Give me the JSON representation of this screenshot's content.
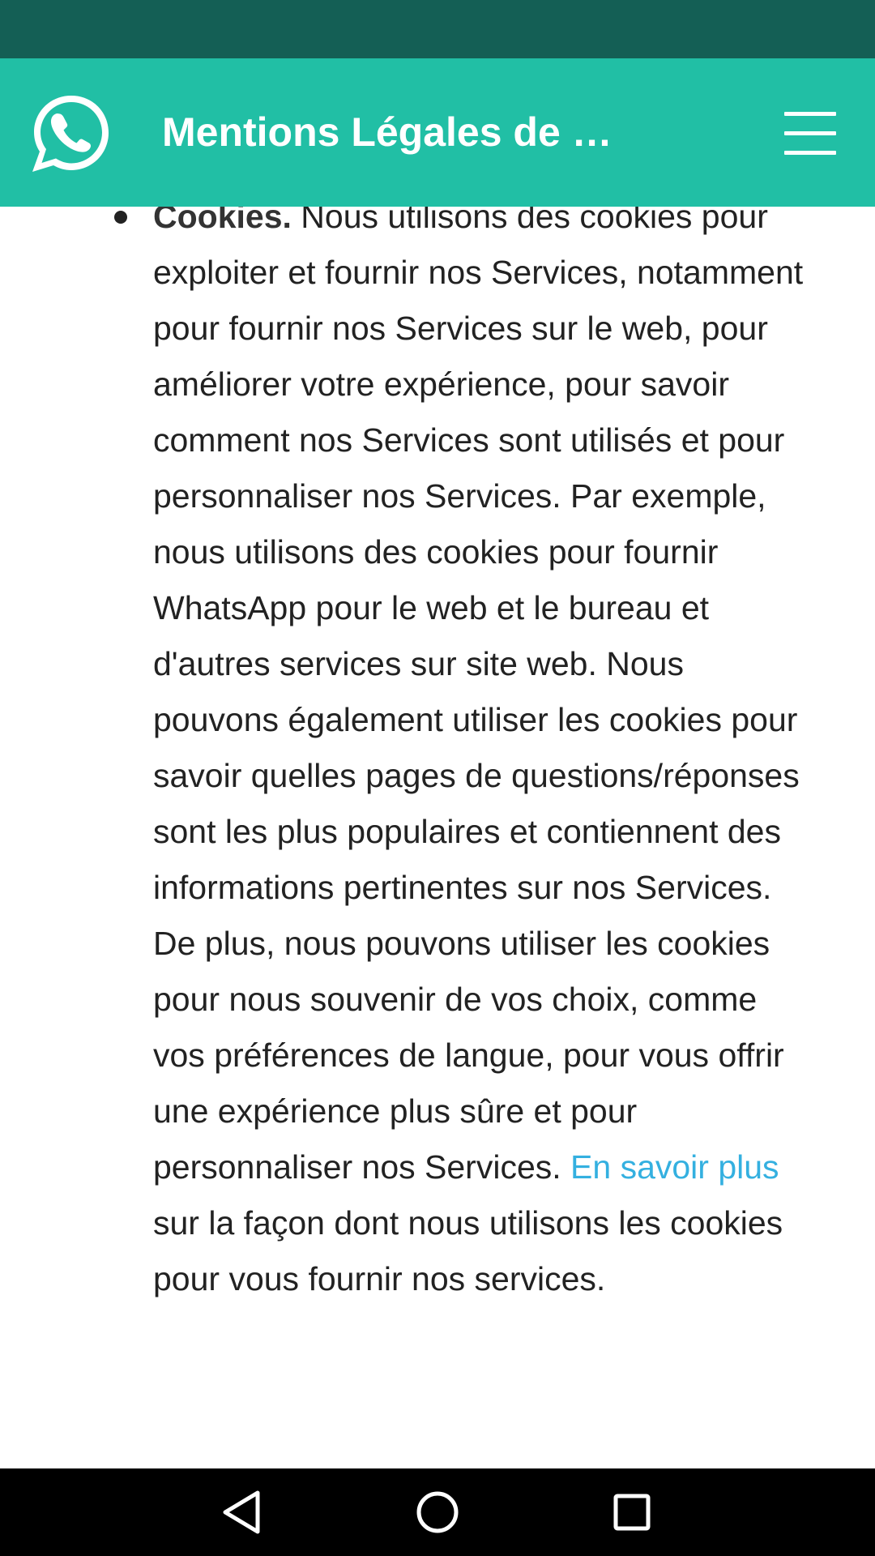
{
  "header": {
    "title": "Mentions Légales de …",
    "logo_icon": "whatsapp-logo-icon",
    "menu_icon": "hamburger-menu-icon",
    "background_color": "#21bfa5",
    "status_bar_color": "#145f55"
  },
  "content": {
    "cookies_item": {
      "heading": "Cookies.",
      "text_before_link": " Nous utilisons des cookies pour exploiter et fournir nos Services, notamment pour fournir nos Services sur le web, pour améliorer votre expérience, pour savoir comment nos Services sont utilisés et pour personnaliser nos Services. Par exemple, nous utilisons des cookies pour fournir WhatsApp pour le web et le bureau et d'autres services sur site web. Nous pouvons également utiliser les cookies pour savoir quelles pages de questions/réponses sont les plus populaires et contiennent des informations pertinentes sur nos Services. De plus, nous pouvons utiliser les cookies pour nous souvenir de vos choix, comme vos préférences de langue, pour vous offrir une expérience plus sûre et pour personnaliser nos Services. ",
      "link_text": "En savoir plus",
      "text_after_link": " sur la façon dont nous utilisons les cookies pour vous fournir nos services.",
      "link_color": "#34b0e0"
    }
  },
  "nav_bar": {
    "back_icon": "back-triangle-icon",
    "home_icon": "home-circle-icon",
    "recents_icon": "recents-square-icon"
  }
}
